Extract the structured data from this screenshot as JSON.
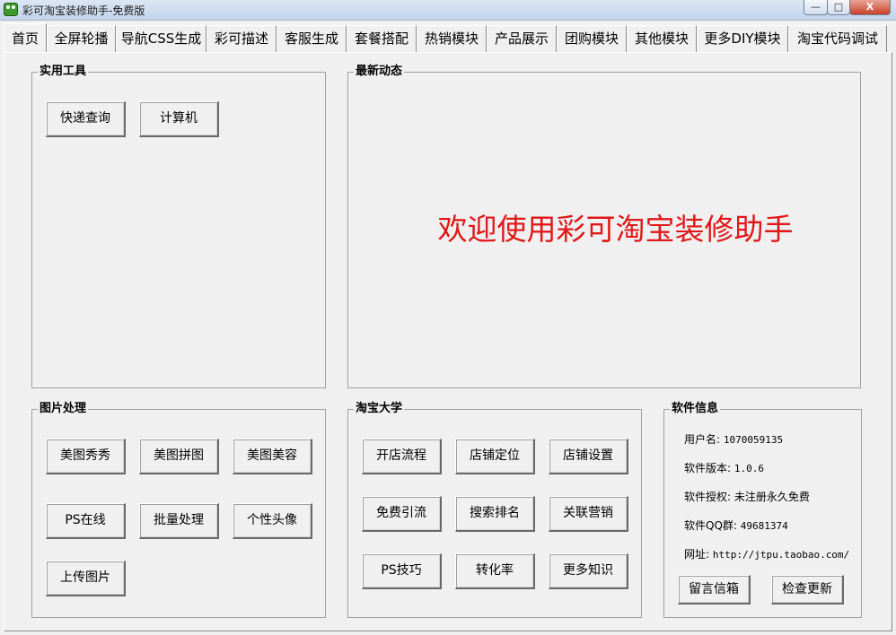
{
  "window": {
    "title": "彩可淘宝装修助手-免费版",
    "minimize": "—",
    "maximize": "□",
    "close": "X"
  },
  "tabs": [
    "首页",
    "全屏轮播",
    "导航CSS生成",
    "彩可描述",
    "客服生成",
    "套餐搭配",
    "热销模块",
    "产品展示",
    "团购模块",
    "其他模块",
    "更多DIY模块",
    "淘宝代码调试"
  ],
  "tools": {
    "title": "实用工具",
    "buttons": [
      "快递查询",
      "计算机"
    ]
  },
  "news": {
    "title": "最新动态",
    "welcome": "欢迎使用彩可淘宝装修助手"
  },
  "image": {
    "title": "图片处理",
    "buttons": [
      "美图秀秀",
      "美图拼图",
      "美图美容",
      "PS在线",
      "批量处理",
      "个性头像",
      "上传图片"
    ]
  },
  "university": {
    "title": "淘宝大学",
    "buttons": [
      "开店流程",
      "店铺定位",
      "店铺设置",
      "免费引流",
      "搜索排名",
      "关联营销",
      "PS技巧",
      "转化率",
      "更多知识"
    ]
  },
  "software": {
    "title": "软件信息",
    "rows": [
      {
        "label": "用户名: ",
        "value": "1070059135"
      },
      {
        "label": "软件版本: ",
        "value": "1.0.6"
      },
      {
        "label": "软件授权: ",
        "value": "未注册永久免费"
      },
      {
        "label": "软件QQ群: ",
        "value": "49681374"
      },
      {
        "label": "网址: ",
        "value": "http://jtpu.taobao.com/"
      }
    ],
    "message_button": "留言信箱",
    "update_button": "检查更新"
  }
}
